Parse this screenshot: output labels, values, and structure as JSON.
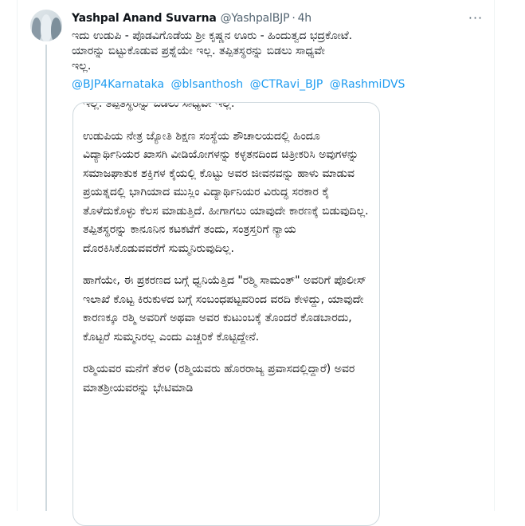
{
  "tweet": {
    "author_name": "Yashpal Anand Suvarna",
    "handle": "@YashpalBJP",
    "separator": "·",
    "time": "4h",
    "more_icon": "more-horizontal-icon",
    "text_lines": [
      "ಇದು ಉಡುಪಿ - ಪೊಡವಿಗೊಡೆಯ ಶ್ರೀ ಕೃಷ್ಣನ ಊರು - ಹಿಂದುತ್ವದ ಭದ್ರಕೋಟೆ.",
      "ಯಾರನ್ನು ಬಿಟ್ಟುಕೊಡುವ ಪ್ರಶ್ನೆಯೇ ಇಲ್ಲ. ತಪ್ಪಿತಸ್ಥರನ್ನು ಬಿಡಲು ಸಾಧ್ಯವೇ",
      "ಇಲ್ಲ."
    ],
    "mentions": [
      "@BJP4Karnataka",
      "@blsanthosh",
      "@CTRavi_BJP",
      "@RashmiDVS"
    ]
  },
  "media": {
    "paragraphs": [
      "ಇಲ್ಲ. ತಪ್ಪಿತಸ್ಥರನ್ನು ಬಿಡಲು ಸಾಧ್ಯವೇ ಇಲ್ಲ.",
      "ಉಡುಪಿಯ ನೇತ್ರ ಜ್ಯೋತಿ ಶಿಕ್ಷಣ ಸಂಸ್ಥೆಯ ಶೌಚಾಲಯದಲ್ಲಿ ಹಿಂದೂ ವಿದ್ಯಾರ್ಥಿನಿಯರ ಖಾಸಗಿ ವೀಡಿಯೋಗಳನ್ನು ಕಳ್ಳತನದಿಂದ ಚಿತ್ರೀಕರಿಸಿ ಅವುಗಳನ್ನು ಸಮಾಜಘಾತುಕ ಶಕ್ತಿಗಳ ಕೈಯಲ್ಲಿ ಕೊಟ್ಟು ಅವರ ಜೀವನವನ್ನು ಹಾಳು ಮಾಡುವ ಪ್ರಯತ್ನದಲ್ಲಿ ಭಾಗಿಯಾದ ಮುಸ್ಲಿಂ ವಿದ್ಯಾರ್ಥಿನಿಯರ ವಿರುದ್ಧ ಸರಕಾರ ಕೈ ತೊಳೆದುಕೊಳ್ಳು ಕೆಲಸ ಮಾಡುತ್ತಿದೆ. ಹೀಗಾಗಲು ಯಾವುದೇ ಕಾರಣಕ್ಕೆ ಬಿಡುವುದಿಲ್ಲ. ತಪ್ಪಿತಸ್ಥರನ್ನು ಕಾನೂನಿನ ಕಟಕಟೆಗೆ ತಂದು, ಸಂತ್ರಸ್ತರಿಗೆ ನ್ಯಾಯ ದೊರಕಿಸಿಕೊಡುವವರೆಗೆ ಸುಮ್ಮನಿರುವುದಿಲ್ಲ.",
      "ಹಾಗೆಯೇ, ಈ ಪ್ರಕರಣದ ಬಗ್ಗೆ ಧ್ವನಿಯೆತ್ತಿದ \"ರಶ್ಮಿ ಸಾಮಂತ್\" ಅವರಿಗೆ ಪೊಲೀಸ್ ಇಲಾಖೆ ಕೊಟ್ಟ ಕಿರುಕುಳದ ಬಗ್ಗೆ ಸಂಬಂಧಪಟ್ಟವರಿಂದ ವರದಿ ಕೇಳಿದ್ದು, ಯಾವುದೇ ಕಾರಣಕ್ಕೂ ರಶ್ಮಿ ಅವರಿಗೆ ಅಥವಾ ಅವರ ಕುಟುಂಬಕ್ಕೆ ತೊಂದರೆ ಕೊಡಬಾರದು, ಕೊಟ್ಟರೆ ಸುಮ್ಮನಿರಲ್ಲ ಎಂದು ಎಚ್ಚರಿಕೆ ಕೊಟ್ಟಿದ್ದೇನೆ.",
      "ರಶ್ಮಿಯವರ ಮನೆಗೆ ತೆರಳಿ (ರಶ್ಮಿಯವರು ಹೊರರಾಜ್ಯ ಪ್ರವಾಸದಲ್ಲಿದ್ದಾರೆ) ಅವರ ಮಾತಶ್ರೀಯವರನ್ನು ಭೇಟಿಮಾಡಿ"
    ]
  }
}
